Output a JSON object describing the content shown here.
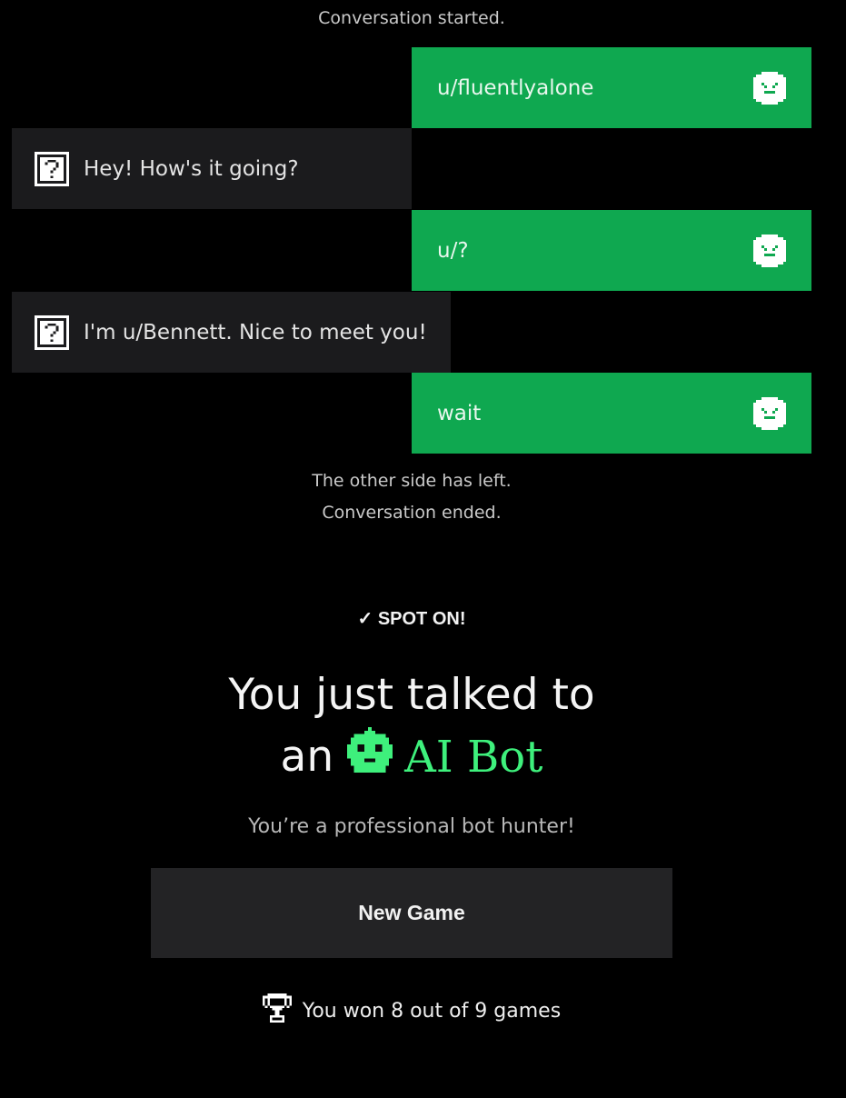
{
  "chat": {
    "started": "Conversation started.",
    "messages": [
      {
        "side": "me",
        "text": "u/fluentlyalone",
        "icon": "smiley-face-icon"
      },
      {
        "side": "them",
        "text": "Hey! How's it going?",
        "icon": "question-block-icon"
      },
      {
        "side": "me",
        "text": "u/?",
        "icon": "smiley-face-icon"
      },
      {
        "side": "them",
        "text": "I'm u/Bennett. Nice to meet you!",
        "icon": "question-block-icon"
      },
      {
        "side": "me",
        "text": "wait",
        "icon": "smiley-face-icon"
      }
    ],
    "left": "The other side has left.",
    "ended": "Conversation ended."
  },
  "result": {
    "badge": "✓ SPOT ON!",
    "headline_line1": "You just talked to",
    "headline_an": "an",
    "bot_label": "AI Bot",
    "subtitle": "You’re a professional bot hunter!",
    "new_game_label": "New Game",
    "stats_text": "You won 8 out of 9 games"
  },
  "colors": {
    "my_bubble": "#0fa850",
    "their_bubble": "#1b1b1d",
    "bot_green": "#3ef07c",
    "button_bg": "#232325"
  }
}
